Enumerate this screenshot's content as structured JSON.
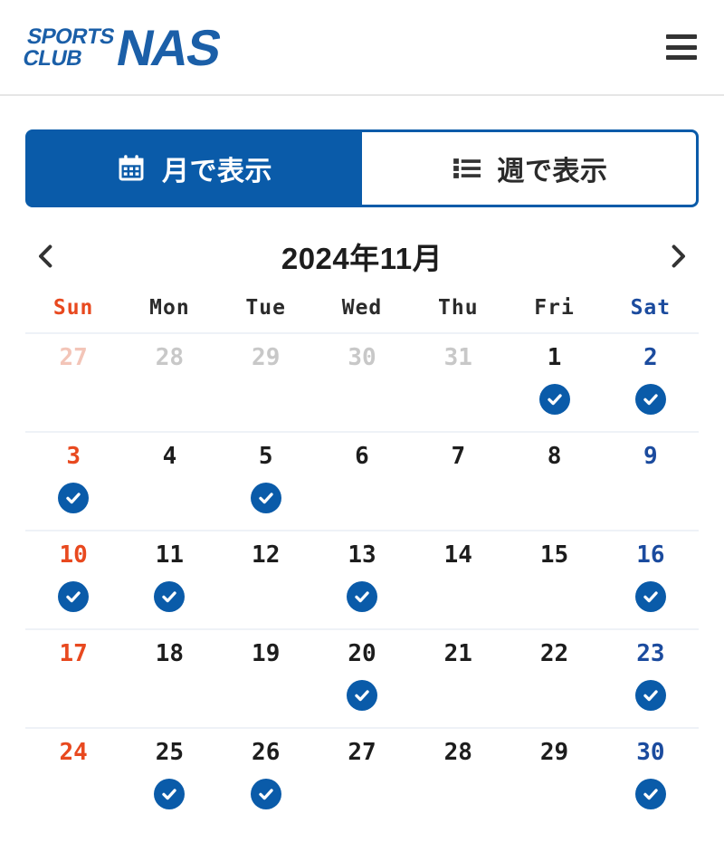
{
  "header": {
    "logo": {
      "line1": "SPORTS",
      "line2": "CLUB",
      "brand": "NAS",
      "color": "#1b5fa8"
    },
    "menu_icon": "hamburger-icon"
  },
  "tabs": [
    {
      "label": "月で表示",
      "icon": "calendar-icon",
      "active": true
    },
    {
      "label": "週で表示",
      "icon": "list-icon",
      "active": false
    }
  ],
  "month_nav": {
    "prev_icon": "chevron-left-icon",
    "next_icon": "chevron-right-icon",
    "title": "2024年11月"
  },
  "calendar": {
    "weekday_headers": [
      "Sun",
      "Mon",
      "Tue",
      "Wed",
      "Thu",
      "Fri",
      "Sat"
    ],
    "accent_color": "#0a5ba9",
    "sunday_color": "#e8491f",
    "saturday_color": "#1b4b9e",
    "weeks": [
      [
        {
          "day": "27",
          "month": "prev",
          "checked": false
        },
        {
          "day": "28",
          "month": "prev",
          "checked": false
        },
        {
          "day": "29",
          "month": "prev",
          "checked": false
        },
        {
          "day": "30",
          "month": "prev",
          "checked": false
        },
        {
          "day": "31",
          "month": "prev",
          "checked": false
        },
        {
          "day": "1",
          "month": "current",
          "checked": true
        },
        {
          "day": "2",
          "month": "current",
          "checked": true
        }
      ],
      [
        {
          "day": "3",
          "month": "current",
          "checked": true
        },
        {
          "day": "4",
          "month": "current",
          "checked": false
        },
        {
          "day": "5",
          "month": "current",
          "checked": true
        },
        {
          "day": "6",
          "month": "current",
          "checked": false
        },
        {
          "day": "7",
          "month": "current",
          "checked": false
        },
        {
          "day": "8",
          "month": "current",
          "checked": false
        },
        {
          "day": "9",
          "month": "current",
          "checked": false
        }
      ],
      [
        {
          "day": "10",
          "month": "current",
          "checked": true
        },
        {
          "day": "11",
          "month": "current",
          "checked": true
        },
        {
          "day": "12",
          "month": "current",
          "checked": false
        },
        {
          "day": "13",
          "month": "current",
          "checked": true
        },
        {
          "day": "14",
          "month": "current",
          "checked": false
        },
        {
          "day": "15",
          "month": "current",
          "checked": false
        },
        {
          "day": "16",
          "month": "current",
          "checked": true
        }
      ],
      [
        {
          "day": "17",
          "month": "current",
          "checked": false
        },
        {
          "day": "18",
          "month": "current",
          "checked": false
        },
        {
          "day": "19",
          "month": "current",
          "checked": false
        },
        {
          "day": "20",
          "month": "current",
          "checked": true
        },
        {
          "day": "21",
          "month": "current",
          "checked": false
        },
        {
          "day": "22",
          "month": "current",
          "checked": false
        },
        {
          "day": "23",
          "month": "current",
          "checked": true
        }
      ],
      [
        {
          "day": "24",
          "month": "current",
          "checked": false
        },
        {
          "day": "25",
          "month": "current",
          "checked": true
        },
        {
          "day": "26",
          "month": "current",
          "checked": true
        },
        {
          "day": "27",
          "month": "current",
          "checked": false
        },
        {
          "day": "28",
          "month": "current",
          "checked": false
        },
        {
          "day": "29",
          "month": "current",
          "checked": false
        },
        {
          "day": "30",
          "month": "current",
          "checked": true
        }
      ]
    ]
  }
}
